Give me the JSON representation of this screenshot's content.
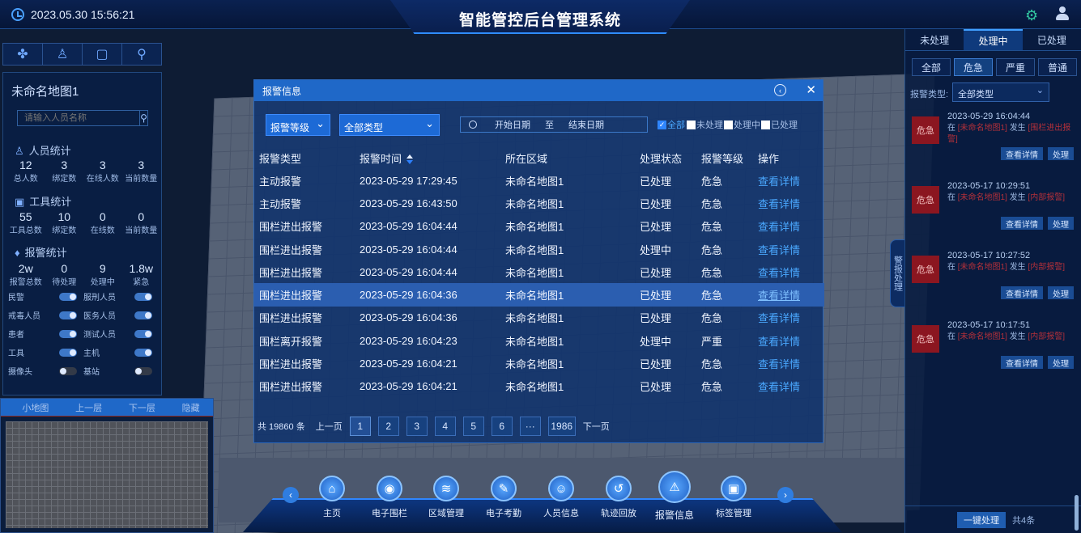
{
  "header": {
    "datetime": "2023.05.30 15:56:21",
    "title": "智能管控后台管理系统"
  },
  "left": {
    "map_name": "未命名地图1",
    "search_placeholder": "请输入人员名称",
    "person_title": "人员统计",
    "person_stats": [
      {
        "v": "12",
        "l": "总人数"
      },
      {
        "v": "3",
        "l": "绑定数"
      },
      {
        "v": "3",
        "l": "在线人数"
      },
      {
        "v": "3",
        "l": "当前数量"
      }
    ],
    "tool_title": "工具统计",
    "tool_stats": [
      {
        "v": "55",
        "l": "工具总数"
      },
      {
        "v": "10",
        "l": "绑定数"
      },
      {
        "v": "0",
        "l": "在线数"
      },
      {
        "v": "0",
        "l": "当前数量"
      }
    ],
    "alarm_title": "报警统计",
    "alarm_stats": [
      {
        "v": "2w",
        "l": "报警总数"
      },
      {
        "v": "0",
        "l": "待处理"
      },
      {
        "v": "9",
        "l": "处理中"
      },
      {
        "v": "1.8w",
        "l": "紧急"
      }
    ],
    "toggles": [
      [
        "民警",
        "服刑人员"
      ],
      [
        "戒毒人员",
        "医务人员"
      ],
      [
        "患者",
        "测试人员"
      ],
      [
        "工具",
        "主机"
      ],
      [
        "摄像头",
        "基站"
      ]
    ],
    "minimap": [
      "小地图",
      "上一层",
      "下一层",
      "隐藏"
    ]
  },
  "modal": {
    "title": "报警信息",
    "level_select": "报警等级",
    "type_select": "全部类型",
    "start_date": "开始日期",
    "to": "至",
    "end_date": "结束日期",
    "checks": [
      "全部",
      "未处理",
      "处理中",
      "已处理"
    ],
    "columns": [
      "报警类型",
      "报警时间",
      "所在区域",
      "处理状态",
      "报警等级",
      "操作"
    ],
    "rows": [
      [
        "主动报警",
        "2023-05-29 17:29:45",
        "未命名地图1",
        "已处理",
        "危急",
        "查看详情"
      ],
      [
        "主动报警",
        "2023-05-29 16:43:50",
        "未命名地图1",
        "已处理",
        "危急",
        "查看详情"
      ],
      [
        "围栏进出报警",
        "2023-05-29 16:04:44",
        "未命名地图1",
        "已处理",
        "危急",
        "查看详情"
      ],
      [
        "围栏进出报警",
        "2023-05-29 16:04:44",
        "未命名地图1",
        "处理中",
        "危急",
        "查看详情"
      ],
      [
        "围栏进出报警",
        "2023-05-29 16:04:44",
        "未命名地图1",
        "已处理",
        "危急",
        "查看详情"
      ],
      [
        "围栏进出报警",
        "2023-05-29 16:04:36",
        "未命名地图1",
        "已处理",
        "危急",
        "查看详情"
      ],
      [
        "围栏进出报警",
        "2023-05-29 16:04:36",
        "未命名地图1",
        "已处理",
        "危急",
        "查看详情"
      ],
      [
        "围栏离开报警",
        "2023-05-29 16:04:23",
        "未命名地图1",
        "处理中",
        "严重",
        "查看详情"
      ],
      [
        "围栏进出报警",
        "2023-05-29 16:04:21",
        "未命名地图1",
        "已处理",
        "危急",
        "查看详情"
      ],
      [
        "围栏进出报警",
        "2023-05-29 16:04:21",
        "未命名地图1",
        "已处理",
        "危急",
        "查看详情"
      ]
    ],
    "total": "共 19860 条",
    "prev": "上一页",
    "pages": [
      "1",
      "2",
      "3",
      "4",
      "5",
      "6",
      "···",
      "1986"
    ],
    "next": "下一页"
  },
  "right": {
    "tabs": [
      "未处理",
      "处理中",
      "已处理"
    ],
    "levels": [
      "全部",
      "危急",
      "严重",
      "普通"
    ],
    "type_label": "报警类型:",
    "type_value": "全部类型",
    "cards": [
      {
        "level": "危急",
        "time": "2023-05-29 16:04:44",
        "pre": "在",
        "map": "[未命名地图1]",
        "mid": "发生",
        "what": "[围栏进出报警]",
        "btn1": "查看详情",
        "btn2": "处理"
      },
      {
        "level": "危急",
        "time": "2023-05-17 10:29:51",
        "pre": "在",
        "map": "[未命名地图1]",
        "mid": "发生",
        "what": "[内部报警]",
        "btn1": "查看详情",
        "btn2": "处理"
      },
      {
        "level": "危急",
        "time": "2023-05-17 10:27:52",
        "pre": "在",
        "map": "[未命名地图1]",
        "mid": "发生",
        "what": "[内部报警]",
        "btn1": "查看详情",
        "btn2": "处理"
      },
      {
        "level": "危急",
        "time": "2023-05-17 10:17:51",
        "pre": "在",
        "map": "[未命名地图1]",
        "mid": "发生",
        "what": "[内部报警]",
        "btn1": "查看详情",
        "btn2": "处理"
      }
    ],
    "one_click": "一键处理",
    "count": "共4条",
    "side_tab": "警报处理"
  },
  "nav": [
    {
      "label": "主页",
      "icon": "home-icon",
      "glyph": "⌂"
    },
    {
      "label": "电子围栏",
      "icon": "fence-icon",
      "glyph": "◉"
    },
    {
      "label": "区域管理",
      "icon": "layers-icon",
      "glyph": "≋"
    },
    {
      "label": "电子考勤",
      "icon": "attendance-icon",
      "glyph": "✎"
    },
    {
      "label": "人员信息",
      "icon": "person-icon",
      "glyph": "☺"
    },
    {
      "label": "轨迹回放",
      "icon": "replay-icon",
      "glyph": "↺"
    },
    {
      "label": "报警信息",
      "icon": "alarm-icon",
      "glyph": "⚠"
    },
    {
      "label": "标签管理",
      "icon": "tag-icon",
      "glyph": "▣"
    }
  ]
}
